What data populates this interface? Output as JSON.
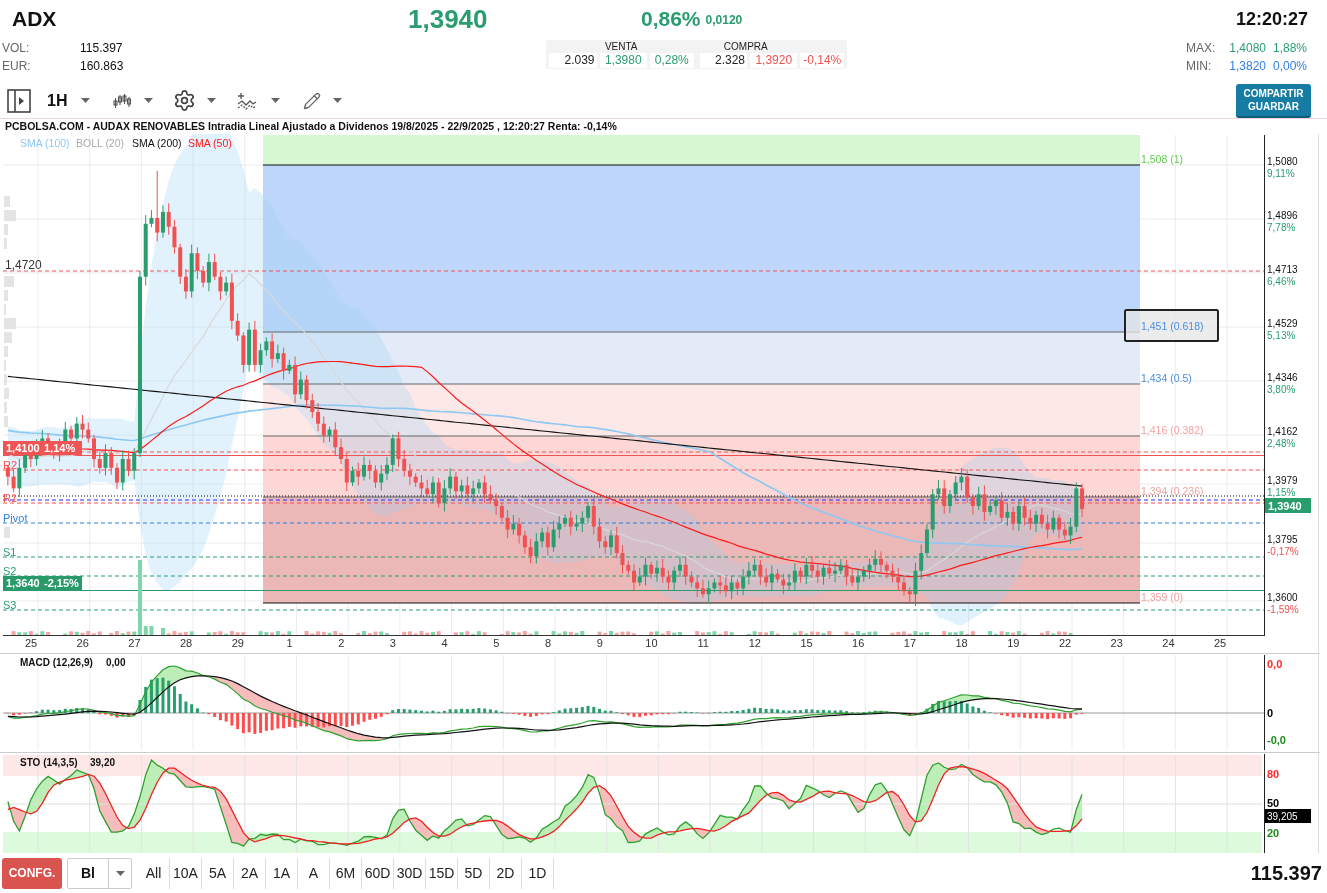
{
  "header": {
    "symbol": "ADX",
    "price": "1,3940",
    "change_percent": "0,86%",
    "change": "0,0120",
    "time": "12:20:27"
  },
  "stats": [
    {
      "label": "VOL:",
      "value": "115.397"
    },
    {
      "label": "EUR:",
      "value": "160.863"
    }
  ],
  "order_book": [
    {
      "title": "VENTA",
      "quantity": "2.039",
      "price": "1,3980",
      "change": "0,28%",
      "kind": "gain"
    },
    {
      "title": "COMPRA",
      "quantity": "2.328",
      "price": "1,3920",
      "change": "-0,14%",
      "kind": "loss"
    }
  ],
  "day_range": [
    {
      "label": "MAX:",
      "price": "1,4080",
      "change": "1,88%",
      "color": "#2a9d6f"
    },
    {
      "label": "MIN:",
      "price": "1,3820",
      "change": "0,00%",
      "color": "#2f7fe0"
    }
  ],
  "toolbar": {
    "interval": "1H",
    "share_button": [
      "COMPARTIR",
      "GUARDAR"
    ]
  },
  "chart": {
    "title": "PCBOLSA.COM - AUDAX RENOVABLES Intradia Lineal Ajustado a Dividenos 19/8/2025 - 22/9/2025 , 12:20:27 Renta: -0,14%",
    "legend": [
      {
        "label": "SMA (100)",
        "color": "#8cc8f2"
      },
      {
        "label": "BOLL (20)",
        "color": "#a9a9a9"
      },
      {
        "label": "SMA (200)",
        "color": "#111111"
      },
      {
        "label": "SMA (50)",
        "color": "#ff1a1a"
      }
    ],
    "reference_line": {
      "label": "1,4720"
    },
    "price_tags": [
      {
        "price": "1,4100",
        "change": "1,14%",
        "color": "#f05454"
      },
      {
        "price": "1,3640",
        "change": "-2,15%",
        "color": "#2b9a6b"
      }
    ],
    "pivots": [
      {
        "label": "R2",
        "color": "#ff4d4d"
      },
      {
        "label": "R1",
        "color": "#ff4d4d"
      },
      {
        "label": "Pivot",
        "color": "#2f7fe0"
      },
      {
        "label": "S1",
        "color": "#2a9d6f"
      },
      {
        "label": "S2",
        "color": "#2a9d6f"
      },
      {
        "label": "S3",
        "color": "#2a9d6f"
      }
    ],
    "fibonacci": [
      {
        "label": "1,508 (1)",
        "color": "#5fcc4f",
        "highlighted": false
      },
      {
        "label": "1,451 (0.618)",
        "color": "#4a8fe0",
        "highlighted": true
      },
      {
        "label": "1,434 (0.5)",
        "color": "#4a8fe0",
        "highlighted": false
      },
      {
        "label": "1,416 (0.382)",
        "color": "#f2a2a2",
        "highlighted": false
      },
      {
        "label": "1,394 (0.236)",
        "color": "#f2a2a2",
        "highlighted": false
      },
      {
        "label": "1,359 (0)",
        "color": "#f2a2a2",
        "highlighted": false
      }
    ],
    "price_axis": [
      {
        "price": "1,5080",
        "change": "9,11%",
        "kind": "gain"
      },
      {
        "price": "1,4896",
        "change": "7,78%",
        "kind": "gain"
      },
      {
        "price": "1,4713",
        "change": "6,46%",
        "kind": "gain"
      },
      {
        "price": "1,4529",
        "change": "5,13%",
        "kind": "gain"
      },
      {
        "price": "1,4346",
        "change": "3,80%",
        "kind": "gain"
      },
      {
        "price": "1,4162",
        "change": "2,48%",
        "kind": "gain"
      },
      {
        "price": "1,3979",
        "change": "1,15%",
        "kind": "gain"
      },
      {
        "price": "1,3795",
        "change": "-0,17%",
        "kind": "loss"
      },
      {
        "price": "1,3600",
        "change": "-1,59%",
        "kind": "loss"
      }
    ],
    "current_price": "1,3940",
    "dates": [
      "25",
      "26",
      "27",
      "28",
      "29",
      "1",
      "2",
      "3",
      "4",
      "5",
      "8",
      "9",
      "10",
      "11",
      "12",
      "15",
      "16",
      "17",
      "18",
      "19",
      "22",
      "23",
      "24",
      "25"
    ]
  },
  "macd": {
    "title": "MACD (12,26,9)",
    "value": "0,00",
    "axis": [
      {
        "label": "0,0",
        "color": "#ff2a2a"
      },
      {
        "label": "0",
        "color": "#000000"
      },
      {
        "label": "-0,0",
        "color": "#1a8a1a"
      }
    ]
  },
  "stochastic": {
    "title": "STO (14,3,5)",
    "value": "39,20",
    "axis": [
      {
        "label": "80",
        "color": "#ff2a2a"
      },
      {
        "label": "50",
        "color": "#000000"
      },
      {
        "label": "20",
        "color": "#1a8a1a"
      }
    ],
    "current_value": "39,205"
  },
  "footer": {
    "config_button": "CONFG.",
    "chart_style": "Bl",
    "ranges": [
      {
        "label": "All",
        "selected": false
      },
      {
        "label": "10A",
        "selected": false
      },
      {
        "label": "5A",
        "selected": false
      },
      {
        "label": "2A",
        "selected": false
      },
      {
        "label": "1A",
        "selected": false
      },
      {
        "label": "A",
        "selected": false
      },
      {
        "label": "6M",
        "selected": false
      },
      {
        "label": "60D",
        "selected": false
      },
      {
        "label": "30D",
        "selected": false
      },
      {
        "label": "15D",
        "selected": false
      },
      {
        "label": "5D",
        "selected": false
      },
      {
        "label": "2D",
        "selected": false
      },
      {
        "label": "1D",
        "selected": false
      }
    ],
    "volume": "115.397"
  }
}
